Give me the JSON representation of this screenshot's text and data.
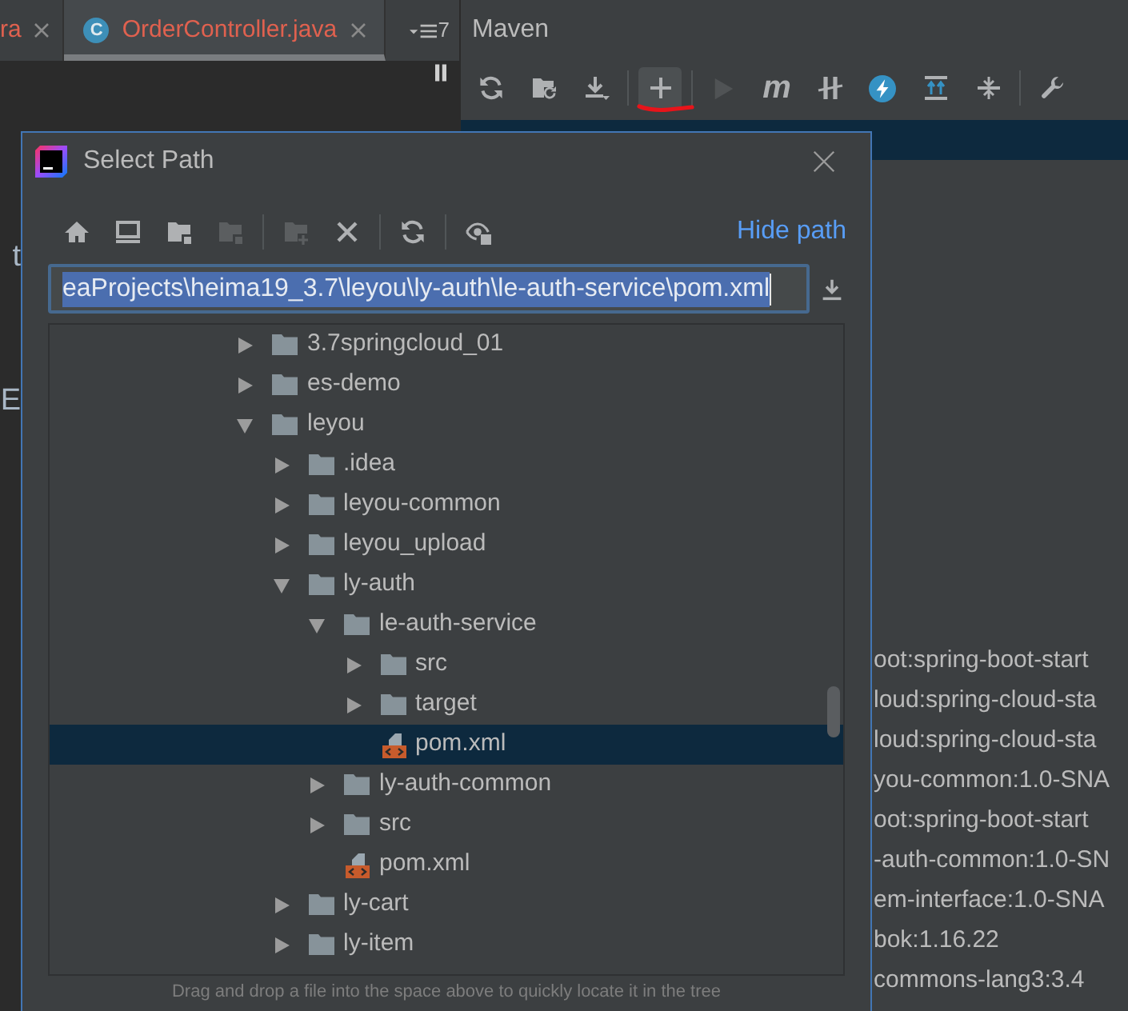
{
  "editor": {
    "tabs": [
      {
        "label": "ra",
        "error": true,
        "selected": false
      },
      {
        "label": "OrderController.java",
        "icon": "C",
        "error": true,
        "selected": true
      }
    ],
    "tab_overflow": {
      "count": "7"
    },
    "code_fragments": [
      "t",
      "E"
    ]
  },
  "maven": {
    "title": "Maven",
    "toolbar": [
      [
        {
          "kind": "reload",
          "disabled": false,
          "hovered": false,
          "annotated": false
        },
        {
          "kind": "reimport",
          "disabled": false,
          "hovered": false,
          "annotated": false
        },
        {
          "kind": "download",
          "disabled": false,
          "hovered": false,
          "annotated": false
        }
      ],
      [
        {
          "kind": "add",
          "disabled": false,
          "hovered": true,
          "annotated": true
        }
      ],
      [
        {
          "kind": "run",
          "disabled": true,
          "hovered": false,
          "annotated": false
        },
        {
          "kind": "goal",
          "glyph": "m",
          "disabled": false,
          "hovered": false,
          "annotated": false
        },
        {
          "kind": "offline",
          "disabled": false,
          "hovered": false,
          "annotated": false
        },
        {
          "kind": "skip_tests",
          "disabled": false,
          "hovered": false,
          "annotated": false
        },
        {
          "kind": "expand",
          "disabled": false,
          "hovered": false,
          "annotated": false
        },
        {
          "kind": "collapse",
          "disabled": false,
          "hovered": false,
          "annotated": false
        }
      ],
      [
        {
          "kind": "settings",
          "disabled": false,
          "hovered": false,
          "annotated": false
        }
      ]
    ],
    "tree": {
      "top_row_selected": true,
      "lines": [
        "oot:spring-boot-start",
        "loud:spring-cloud-sta",
        "loud:spring-cloud-sta",
        "you-common:1.0-SNA",
        "oot:spring-boot-start",
        "-auth-common:1.0-SN",
        "em-interface:1.0-SNA",
        "bok:1.16.22",
        "commons-lang3:3.4"
      ]
    }
  },
  "dialog": {
    "title": "Select Path",
    "toolbar": [
      [
        {
          "kind": "home",
          "disabled": false
        },
        {
          "kind": "desktop",
          "disabled": false
        },
        {
          "kind": "project",
          "disabled": false
        },
        {
          "kind": "module",
          "disabled": true
        }
      ],
      [
        {
          "kind": "new_folder",
          "disabled": true
        },
        {
          "kind": "delete",
          "disabled": false
        }
      ],
      [
        {
          "kind": "refresh",
          "disabled": false
        }
      ],
      [
        {
          "kind": "show_hidden",
          "disabled": false
        }
      ]
    ],
    "hide_path_link": "Hide path",
    "path_field": {
      "value": "eaProjects\\heima19_3.7\\leyou\\ly-auth\\le-auth-service\\pom.xml",
      "focused": true,
      "text_selected": true
    },
    "tree": [
      {
        "label": "3.7springcloud_01",
        "kind": "folder",
        "expanded": false,
        "selected": false
      },
      {
        "label": "es-demo",
        "kind": "folder",
        "expanded": false,
        "selected": false
      },
      {
        "label": "leyou",
        "kind": "folder",
        "expanded": true,
        "selected": false,
        "children": [
          {
            "label": ".idea",
            "kind": "folder",
            "expanded": false,
            "selected": false
          },
          {
            "label": "leyou-common",
            "kind": "folder",
            "expanded": false,
            "selected": false
          },
          {
            "label": "leyou_upload",
            "kind": "folder",
            "expanded": false,
            "selected": false
          },
          {
            "label": "ly-auth",
            "kind": "folder",
            "expanded": true,
            "selected": false,
            "children": [
              {
                "label": "le-auth-service",
                "kind": "folder",
                "expanded": true,
                "selected": false,
                "children": [
                  {
                    "label": "src",
                    "kind": "folder",
                    "expanded": false,
                    "selected": false
                  },
                  {
                    "label": "target",
                    "kind": "folder",
                    "expanded": false,
                    "selected": false
                  },
                  {
                    "label": "pom.xml",
                    "kind": "xml_file",
                    "selected": true
                  }
                ]
              },
              {
                "label": "ly-auth-common",
                "kind": "folder",
                "expanded": false,
                "selected": false
              },
              {
                "label": "src",
                "kind": "folder",
                "expanded": false,
                "selected": false
              },
              {
                "label": "pom.xml",
                "kind": "xml_file",
                "selected": false
              }
            ]
          },
          {
            "label": "ly-cart",
            "kind": "folder",
            "expanded": false,
            "selected": false
          },
          {
            "label": "ly-item",
            "kind": "folder",
            "expanded": false,
            "selected": false
          }
        ]
      }
    ],
    "hint": "Drag and drop a file into the space above to quickly locate it in the tree"
  }
}
